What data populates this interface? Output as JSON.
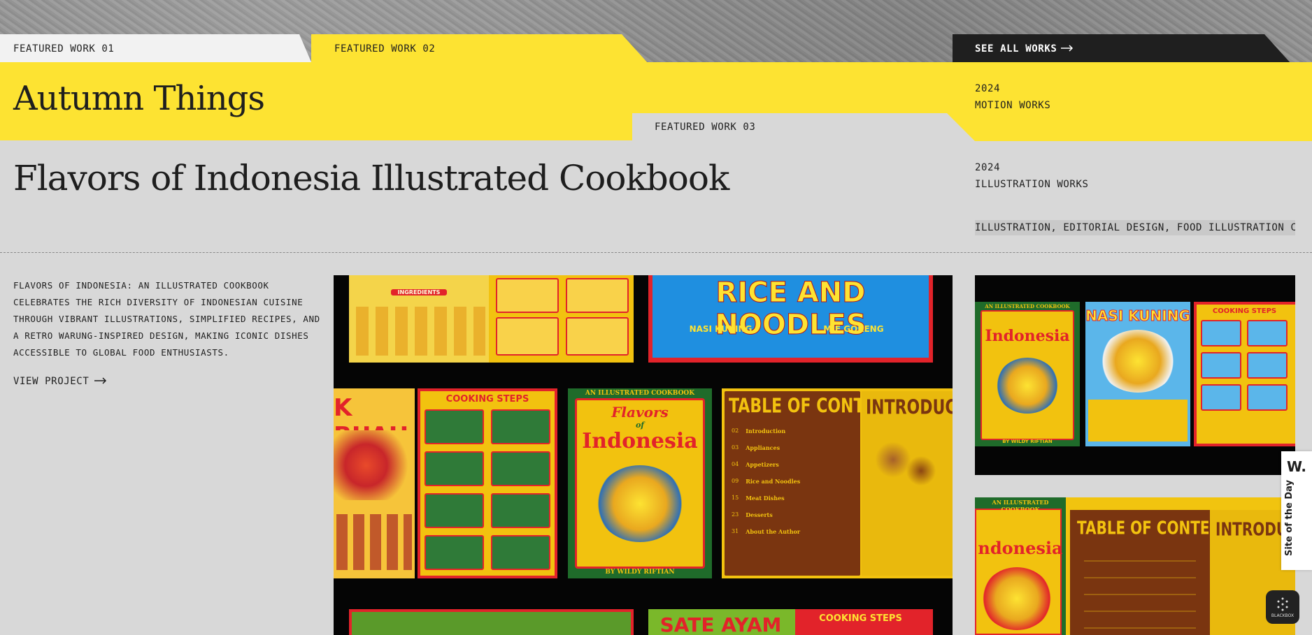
{
  "tabs": {
    "featured_01": "FEATURED WORK 01",
    "featured_02": "FEATURED WORK 02",
    "featured_03": "FEATURED WORK 03",
    "see_all": "SEE ALL WORKS"
  },
  "work_02": {
    "title": "Autumn Things",
    "year": "2024",
    "category": "MOTION WORKS"
  },
  "work_03": {
    "title": "Flavors of Indonesia Illustrated Cookbook",
    "year": "2024",
    "category": "ILLUSTRATION WORKS",
    "tags": "ILLUSTRATION, EDITORIAL DESIGN, FOOD ILLUSTRATION    CO",
    "description": "FLAVORS OF INDONESIA: AN ILLUSTRATED COOKBOOK CELEBRATES THE RICH DIVERSITY OF INDONESIAN CUISINE THROUGH VIBRANT ILLUSTRATIONS, SIMPLIFIED RECIPES, AND A RETRO WARUNG-INSPIRED DESIGN, MAKING ICONIC DISHES ACCESSIBLE TO GLOBAL FOOD ENTHUSIASTS.",
    "view_label": "VIEW PROJECT"
  },
  "gallery": {
    "rice_noodles": "RICE AND NOODLES",
    "nasi_kuning": "NASI KUNING",
    "mie_goreng": "MIE GORENG",
    "cooking_steps": "COOKING STEPS",
    "cover_top": "AN ILLUSTRATED COOKBOOK",
    "cover_flavors": "Flavors",
    "cover_of": "of",
    "cover_title": "Indonesia",
    "cover_author": "BY WILDY RIFTIAN",
    "toc": "TABLE OF CONTENTS",
    "intro": "INTRODUCT",
    "buah": "K BUAH",
    "sate": "SATE AYAM",
    "ingredients": "INGREDIENTS",
    "toc_items": [
      "Introduction",
      "Appliances",
      "Appetizers",
      "Rice and Noodles",
      "Meat Dishes",
      "Desserts",
      "About the Author"
    ],
    "toc_pages": [
      "02",
      "03",
      "04",
      "09",
      "15",
      "23",
      "31"
    ],
    "side_intro": "INTRODUC",
    "side_cover_partial": "ndonesia"
  },
  "award": {
    "logo": "W.",
    "label": "Site of the Day",
    "partner": "BLACKBOX"
  },
  "colors": {
    "yellow": "#fde332",
    "dark": "#1f1f1f",
    "grey": "#d8d8d8",
    "accent_red": "#e2232a",
    "accent_green": "#1f6b2a"
  }
}
